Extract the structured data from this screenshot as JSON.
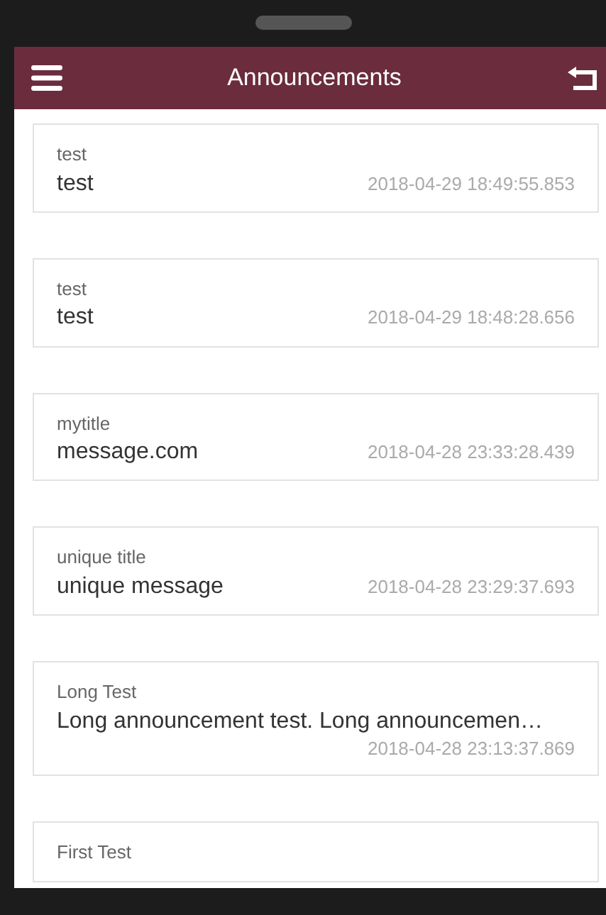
{
  "header": {
    "title": "Announcements"
  },
  "announcements": [
    {
      "kind": "inline",
      "title": "test",
      "message": "test",
      "timestamp": "2018-04-29 18:49:55.853"
    },
    {
      "kind": "inline",
      "title": "test",
      "message": "test",
      "timestamp": "2018-04-29 18:48:28.656"
    },
    {
      "kind": "inline",
      "title": "mytitle",
      "message": "message.com",
      "timestamp": "2018-04-28 23:33:28.439"
    },
    {
      "kind": "inline",
      "title": "unique title",
      "message": "unique message",
      "timestamp": "2018-04-28 23:29:37.693"
    },
    {
      "kind": "stacked",
      "title": "Long Test",
      "message": "Long announcement test. Long announcemen…",
      "timestamp": "2018-04-28 23:13:37.869"
    },
    {
      "kind": "inline",
      "title": "First Test"
    }
  ]
}
